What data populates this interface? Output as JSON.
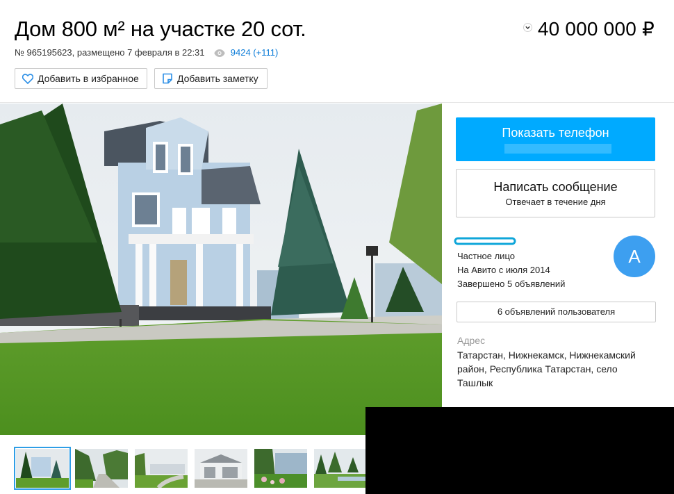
{
  "listing": {
    "title": "Дом 800 м² на участке 20 сот.",
    "meta": "№ 965195623, размещено 7 февраля в 22:31",
    "views": "9424 (+111)",
    "price": "40 000 000 ₽"
  },
  "actions": {
    "favorite_label": "Добавить в избранное",
    "note_label": "Добавить заметку"
  },
  "contact": {
    "phone_label": "Показать телефон",
    "message_label": "Написать сообщение",
    "message_sub": "Отвечает в течение дня"
  },
  "seller": {
    "type": "Частное лицо",
    "since": "На Авито с июля 2014",
    "completed": "Завершено 5 объявлений",
    "avatar_letter": "A",
    "ads_button": "6 объявлений пользователя"
  },
  "address": {
    "label": "Адрес",
    "value": "Татарстан, Нижнекамск, Нижнекамский район, Республика Татарстан, село Ташлык"
  },
  "colors": {
    "accent": "#00aaff",
    "link": "#0a7bd8",
    "avatar": "#3d9ff0"
  },
  "icons": {
    "views": "eye-icon",
    "favorite": "heart-icon",
    "note": "note-icon",
    "price_toggle": "chevron-down-icon"
  }
}
